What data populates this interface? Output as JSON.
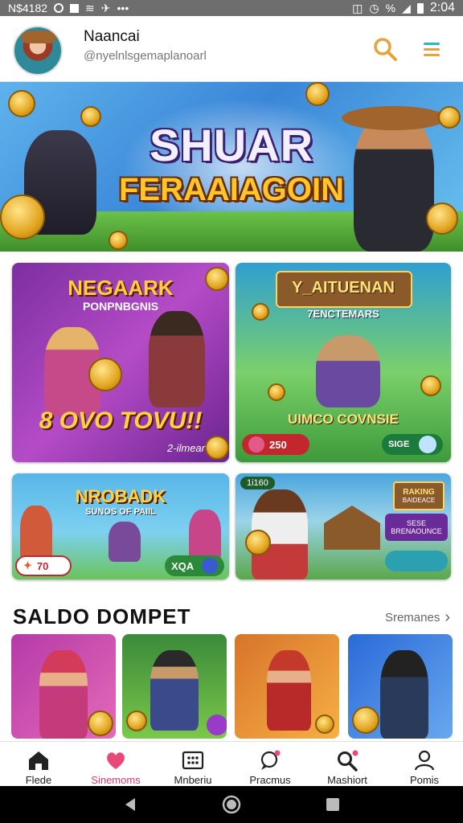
{
  "status_bar": {
    "left_text": "N$4182",
    "time": "2:04",
    "battery_text": "%"
  },
  "header": {
    "username": "Naancai",
    "handle": "@nyelnlsgemaplanoarl",
    "search_icon": "search-icon",
    "menu_icon": "menu-icon"
  },
  "hero": {
    "title_line1": "SHUAR",
    "title_line2": "FERAAIAGOIN"
  },
  "cards": [
    {
      "title": "NEGAARK",
      "subtitle": "PONPNBGNIS",
      "tagline": "8 OVO TOVU!!",
      "badge": "2-ilmear"
    },
    {
      "title": "Y_AITUENAN",
      "subtitle": "7ENCTEMARS",
      "tagline": "UIMCO COVNSIE",
      "pill_value": "250",
      "pill2_text": "SIGE"
    },
    {
      "title": "NROBADK",
      "subtitle": "SUNOS OF PAIIL",
      "pill_value": "70",
      "pill2_text": "XQA"
    },
    {
      "title": "RAKING",
      "subtitle": "BAIDEACE",
      "pill_top": "1i160",
      "side_text1": "SESE",
      "side_text2": "BRENAOUNCE"
    }
  ],
  "section": {
    "title": "SALDO DOMPET",
    "see_all": "Sremanes"
  },
  "thumbnails": [
    {
      "name": "character-pink"
    },
    {
      "name": "character-cowboy"
    },
    {
      "name": "character-red"
    },
    {
      "name": "character-blue"
    }
  ],
  "bottom_nav": [
    {
      "label": "Flede",
      "icon": "home-icon"
    },
    {
      "label": "Sinemoms",
      "icon": "heart-icon",
      "active": true
    },
    {
      "label": "Mnberiu",
      "icon": "grid-icon"
    },
    {
      "label": "Pracmus",
      "icon": "chat-icon"
    },
    {
      "label": "Mashiort",
      "icon": "search-icon"
    },
    {
      "label": "Pomis",
      "icon": "profile-icon"
    }
  ],
  "colors": {
    "accent": "#d43c6e",
    "icon_orange": "#e8a23a",
    "menu_teal": "#2fb5c9"
  }
}
